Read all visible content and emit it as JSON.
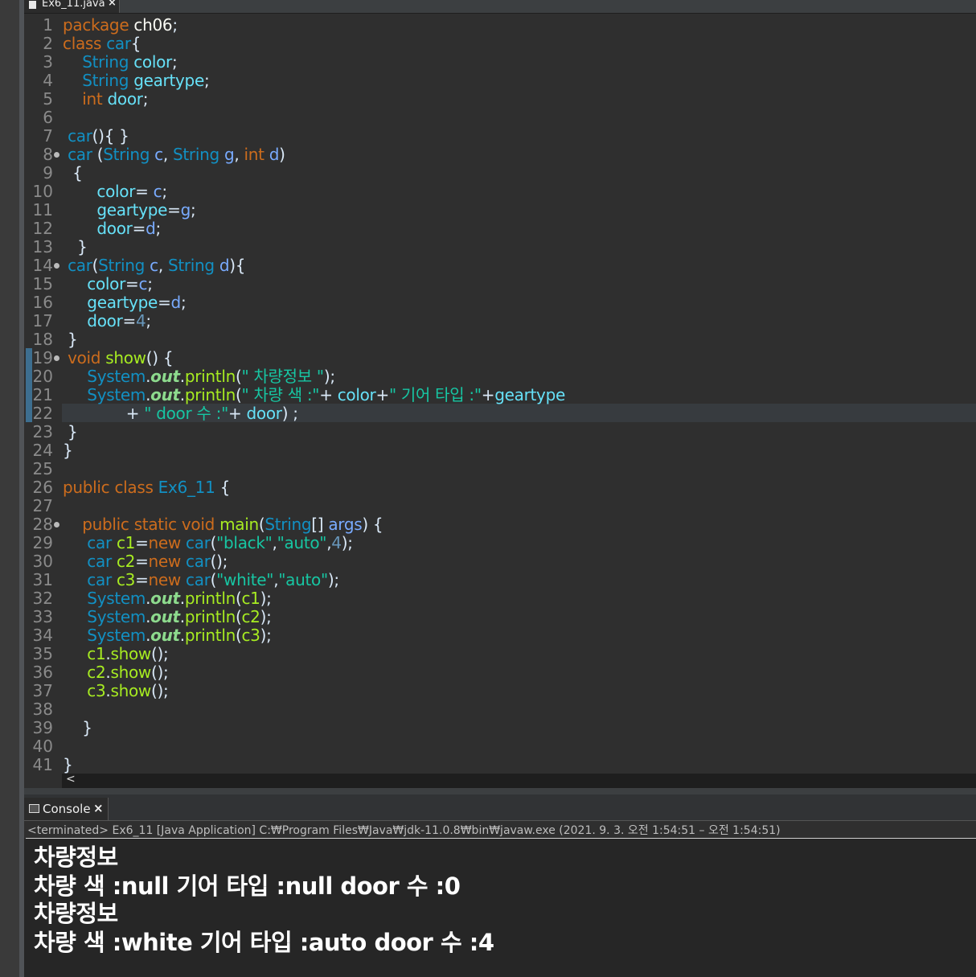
{
  "editor": {
    "tab_label": "Ex6_11.java",
    "tab_close": "×",
    "line_numbers": [
      "1",
      "2",
      "3",
      "4",
      "5",
      "6",
      "7",
      "8",
      "9",
      "10",
      "11",
      "12",
      "13",
      "14",
      "15",
      "16",
      "17",
      "18",
      "19",
      "20",
      "21",
      "22",
      "23",
      "24",
      "25",
      "26",
      "27",
      "28",
      "29",
      "30",
      "31",
      "32",
      "33",
      "34",
      "35",
      "36",
      "37",
      "38",
      "39",
      "40",
      "41"
    ],
    "code": [
      "package ch06;",
      "class car{",
      "    String color;",
      "    String geartype;",
      "    int door;",
      "",
      " car(){ }",
      " car (String c, String g, int d)",
      "  {",
      "       color= c;",
      "       geartype=g;",
      "       door=d;",
      "   }",
      " car(String c, String d){",
      "     color=c;",
      "     geartype=d;",
      "     door=4;",
      " }",
      " void show() {",
      "     System.out.println(\" 차량정보 \");",
      "     System.out.println(\" 차량 색 :\"+ color+\" 기어 타입 :\"+geartype",
      "             + \" door 수 :\"+ door) ;",
      " }",
      "}",
      "",
      "public class Ex6_11 {",
      "",
      "    public static void main(String[] args) {",
      "     car c1=new car(\"black\",\"auto\",4);",
      "     car c2=new car();",
      "     car c3=new car(\"white\",\"auto\");",
      "     System.out.println(c1);",
      "     System.out.println(c2);",
      "     System.out.println(c3);",
      "     c1.show();",
      "     c2.show();",
      "     c3.show();",
      "",
      "    }",
      "",
      "}"
    ],
    "scroll_arrow": "<"
  },
  "console": {
    "tab_label": "Console",
    "tab_close": "×",
    "status": "<terminated> Ex6_11 [Java Application] C:₩Program Files₩Java₩jdk-11.0.8₩bin₩javaw.exe  (2021. 9. 3. 오전 1:54:51 – 오전 1:54:51)",
    "output": [
      "차량정보",
      "차량 색 :null 기어 타입 :null door 수 :0",
      "차량정보",
      "차량 색 :white 기어 타입 :auto door 수 :4"
    ]
  },
  "colors": {
    "keyword": "#cc6c1d",
    "type": "#1290c3",
    "field": "#66e1f8",
    "method": "#a7ec21",
    "string": "#17c6a3",
    "background": "#2f2f2f"
  }
}
